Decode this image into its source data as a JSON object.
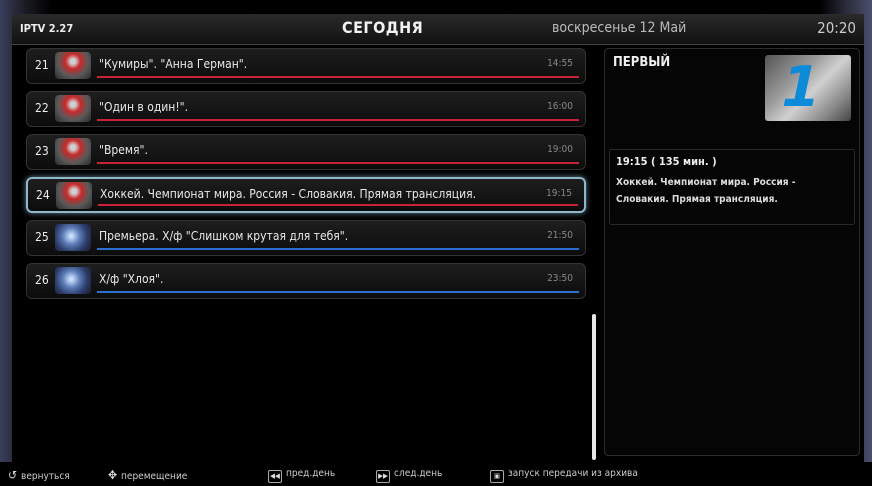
{
  "header": {
    "app_name": "IPTV 2.27",
    "title": "СЕГОДНЯ",
    "date": "воскресенье 12 Май",
    "time": "20:20"
  },
  "programs": [
    {
      "num": "21",
      "title": "\"Кумиры\". \"Анна Герман\".",
      "time": "14:55",
      "color": "red",
      "logo": "ntv-icon"
    },
    {
      "num": "22",
      "title": "\"Один в один!\".",
      "time": "16:00",
      "color": "red",
      "logo": "ntv-icon"
    },
    {
      "num": "23",
      "title": "\"Время\".",
      "time": "19:00",
      "color": "red",
      "logo": "ntv-icon"
    },
    {
      "num": "24",
      "title": "Хоккей. Чемпионат мира. Россия - Словакия. Прямая трансляция.",
      "time": "19:15",
      "color": "red",
      "logo": "ntv-icon",
      "selected": true
    },
    {
      "num": "25",
      "title": "Премьера. Х/ф \"Слишком крутая для тебя\".",
      "time": "21:50",
      "color": "blue",
      "logo": "globe-icon"
    },
    {
      "num": "26",
      "title": "Х/ф \"Хлоя\".",
      "time": "23:50",
      "color": "blue",
      "logo": "globe-icon"
    }
  ],
  "detail": {
    "channel": "ПЕРВЫЙ",
    "logo_text": "1",
    "time_duration": "19:15 ( 135 мин. )",
    "description": "Хоккей. Чемпионат мира. Россия - Словакия. Прямая трансляция."
  },
  "footer": {
    "back": "вернуться",
    "move": "перемещение",
    "prev_day": "пред.день",
    "next_day": "след.день",
    "archive": "запуск передачи из архива"
  },
  "colors": {
    "red_bar": "#c8213a",
    "blue_bar": "#2b6fd0",
    "selection_border": "#8fb8c8",
    "channel_logo_blue": "#0d8bd8"
  }
}
